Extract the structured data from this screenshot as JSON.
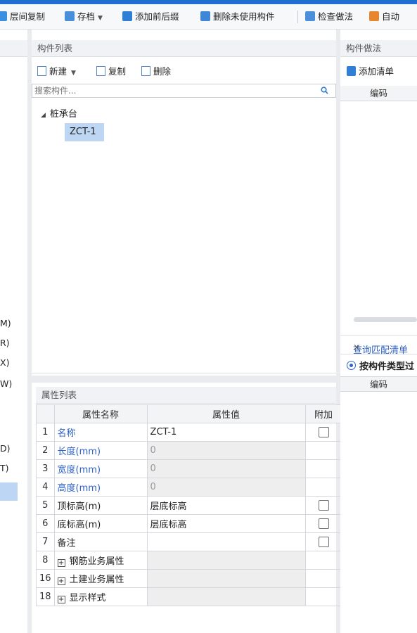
{
  "toolbar": {
    "copy_floor": "层间复制",
    "archive": "存档",
    "add_prefix_suffix": "添加前后缀",
    "delete_unused": "删除未使用构件",
    "check_method": "检查做法",
    "auto": "自动"
  },
  "left_strip": {
    "labels": [
      "M)",
      "R)",
      "X)",
      "W)",
      "D)",
      "T)"
    ]
  },
  "component_list": {
    "title": "构件列表",
    "new_label": "新建",
    "copy_label": "复制",
    "delete_label": "删除",
    "search_placeholder": "搜索构件...",
    "tree_root": "桩承台",
    "tree_child": "ZCT-1"
  },
  "properties": {
    "title": "属性列表",
    "columns": [
      "属性名称",
      "属性值",
      "附加"
    ],
    "rows": [
      {
        "num": "1",
        "name": "名称",
        "value": "ZCT-1",
        "checkbox": true
      },
      {
        "num": "2",
        "name": "长度(mm)",
        "value": "0",
        "checkbox": false
      },
      {
        "num": "3",
        "name": "宽度(mm)",
        "value": "0",
        "checkbox": false
      },
      {
        "num": "4",
        "name": "高度(mm)",
        "value": "0",
        "checkbox": false
      },
      {
        "num": "5",
        "name": "顶标高(m)",
        "value": "层底标高",
        "checkbox": true
      },
      {
        "num": "6",
        "name": "底标高(m)",
        "value": "层底标高",
        "checkbox": true
      },
      {
        "num": "7",
        "name": "备注",
        "value": "",
        "checkbox": true
      },
      {
        "num": "8",
        "name": "钢筋业务属性",
        "value": "",
        "checkbox": false
      },
      {
        "num": "16",
        "name": "土建业务属性",
        "value": "",
        "checkbox": false
      },
      {
        "num": "18",
        "name": "显示样式",
        "value": "",
        "checkbox": false
      }
    ]
  },
  "component_method": {
    "title": "构件做法",
    "add_list": "添加清单",
    "code_header": "编码",
    "query_tab": "查询匹配清单",
    "radio_label": "按构件类型过",
    "code_header_2": "编码"
  },
  "colors": {
    "accent": "#1e6fd0",
    "selection": "#bcd6f3",
    "link_blue": "#2f63c7"
  }
}
